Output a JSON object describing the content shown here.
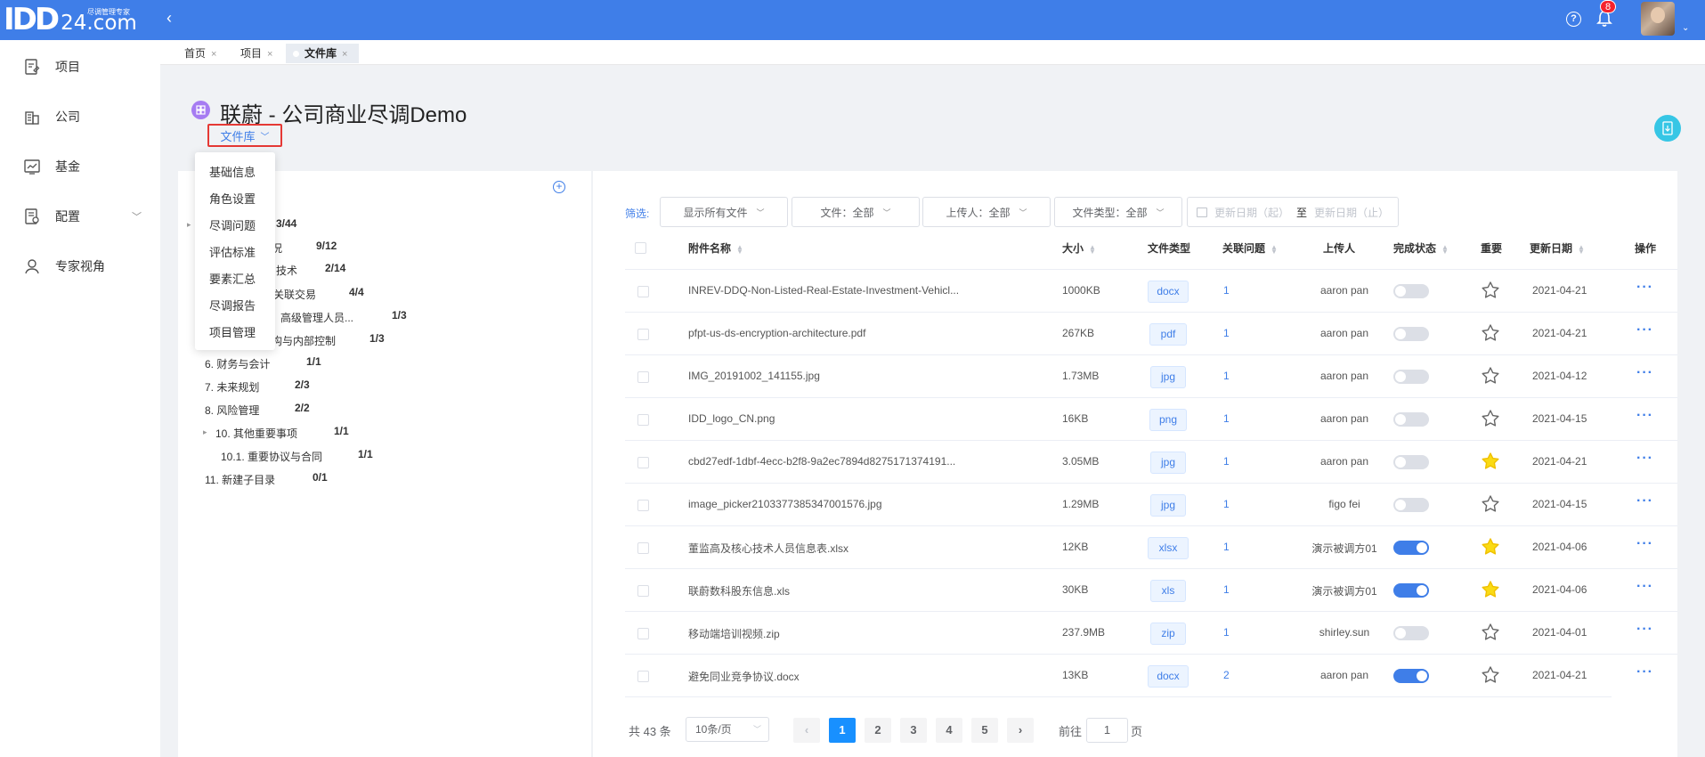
{
  "header": {
    "logo_text": "IDD",
    "logo_num": "24.com",
    "logo_tagline": "尽调管理专家",
    "notification_count": "8"
  },
  "sidebar": {
    "items": [
      {
        "label": "项目",
        "icon": "document-edit-icon"
      },
      {
        "label": "公司",
        "icon": "building-icon"
      },
      {
        "label": "基金",
        "icon": "chart-line-icon"
      },
      {
        "label": "配置",
        "icon": "settings-doc-icon",
        "has_submenu": true
      },
      {
        "label": "专家视角",
        "icon": "expert-icon"
      }
    ]
  },
  "tabs": [
    {
      "label": "首页"
    },
    {
      "label": "项目"
    },
    {
      "label": "文件库",
      "active": true
    }
  ],
  "page": {
    "title": "联蔚 - 公司商业尽调Demo",
    "section_dropdown": "文件库"
  },
  "section_menu": [
    "基础信息",
    "角色设置",
    "尽调问题",
    "评估标准",
    "要素汇总",
    "尽调报告",
    "项目管理"
  ],
  "tree": {
    "root_count": "3/44",
    "items": [
      {
        "label": "况",
        "count": "9/12"
      },
      {
        "label": "技术",
        "count": "2/14"
      },
      {
        "label": "关联交易",
        "count": "4/4"
      },
      {
        "label": "高级管理人员...",
        "count": "1/3"
      },
      {
        "label": "构与内部控制",
        "count": "1/3"
      },
      {
        "label": "6. 财务与会计",
        "count": "1/1"
      },
      {
        "label": "7. 未来规划",
        "count": "2/3"
      },
      {
        "label": "8. 风险管理",
        "count": "2/2"
      },
      {
        "label": "10. 其他重要事项",
        "count": "1/1"
      },
      {
        "label": "10.1. 重要协议与合同",
        "count": "1/1"
      },
      {
        "label": "11. 新建子目录",
        "count": "0/1"
      }
    ]
  },
  "filters": {
    "label": "筛选:",
    "show_files": "显示所有文件",
    "file": "文件：全部",
    "uploader": "上传人：全部",
    "file_type": "文件类型：全部",
    "date_start": "更新日期（起）",
    "date_sep": "至",
    "date_end": "更新日期（止）"
  },
  "table": {
    "columns": {
      "name": "附件名称",
      "size": "大小",
      "type": "文件类型",
      "issues": "关联问题",
      "uploader": "上传人",
      "status": "完成状态",
      "important": "重要",
      "updated": "更新日期",
      "actions": "操作"
    },
    "rows": [
      {
        "name": "INREV-DDQ-Non-Listed-Real-Estate-Investment-Vehicl...",
        "size": "1000KB",
        "type": "docx",
        "issues": "1",
        "uploader": "aaron pan",
        "done": false,
        "important": false,
        "date": "2021-04-21"
      },
      {
        "name": "pfpt-us-ds-encryption-architecture.pdf",
        "size": "267KB",
        "type": "pdf",
        "issues": "1",
        "uploader": "aaron pan",
        "done": false,
        "important": false,
        "date": "2021-04-21"
      },
      {
        "name": "IMG_20191002_141155.jpg",
        "size": "1.73MB",
        "type": "jpg",
        "issues": "1",
        "uploader": "aaron pan",
        "done": false,
        "important": false,
        "date": "2021-04-12"
      },
      {
        "name": "IDD_logo_CN.png",
        "size": "16KB",
        "type": "png",
        "issues": "1",
        "uploader": "aaron pan",
        "done": false,
        "important": false,
        "date": "2021-04-15"
      },
      {
        "name": "cbd27edf-1dbf-4ecc-b2f8-9a2ec7894d8275171374191...",
        "size": "3.05MB",
        "type": "jpg",
        "issues": "1",
        "uploader": "aaron pan",
        "done": false,
        "important": true,
        "date": "2021-04-21"
      },
      {
        "name": "image_picker2103377385347001576.jpg",
        "size": "1.29MB",
        "type": "jpg",
        "issues": "1",
        "uploader": "figo fei",
        "done": false,
        "important": false,
        "date": "2021-04-15"
      },
      {
        "name": "董监高及核心技术人员信息表.xlsx",
        "size": "12KB",
        "type": "xlsx",
        "issues": "1",
        "uploader": "演示被调方01",
        "done": true,
        "important": true,
        "date": "2021-04-06"
      },
      {
        "name": "联蔚数科股东信息.xls",
        "size": "30KB",
        "type": "xls",
        "issues": "1",
        "uploader": "演示被调方01",
        "done": true,
        "important": true,
        "date": "2021-04-06"
      },
      {
        "name": "移动端培训视频.zip",
        "size": "237.9MB",
        "type": "zip",
        "issues": "1",
        "uploader": "shirley.sun",
        "done": false,
        "important": false,
        "date": "2021-04-01"
      },
      {
        "name": "避免同业竞争协议.docx",
        "size": "13KB",
        "type": "docx",
        "issues": "2",
        "uploader": "aaron pan",
        "done": true,
        "important": false,
        "date": "2021-04-21"
      }
    ]
  },
  "pagination": {
    "total": "共 43 条",
    "page_size": "10条/页",
    "pages": [
      "1",
      "2",
      "3",
      "4",
      "5"
    ],
    "current": "1",
    "goto_label": "前往",
    "goto_value": "1",
    "page_suffix": "页"
  },
  "colors": {
    "primary": "#3f7ee8",
    "highlight_border": "#e53935",
    "star_active": "#fadb14"
  }
}
